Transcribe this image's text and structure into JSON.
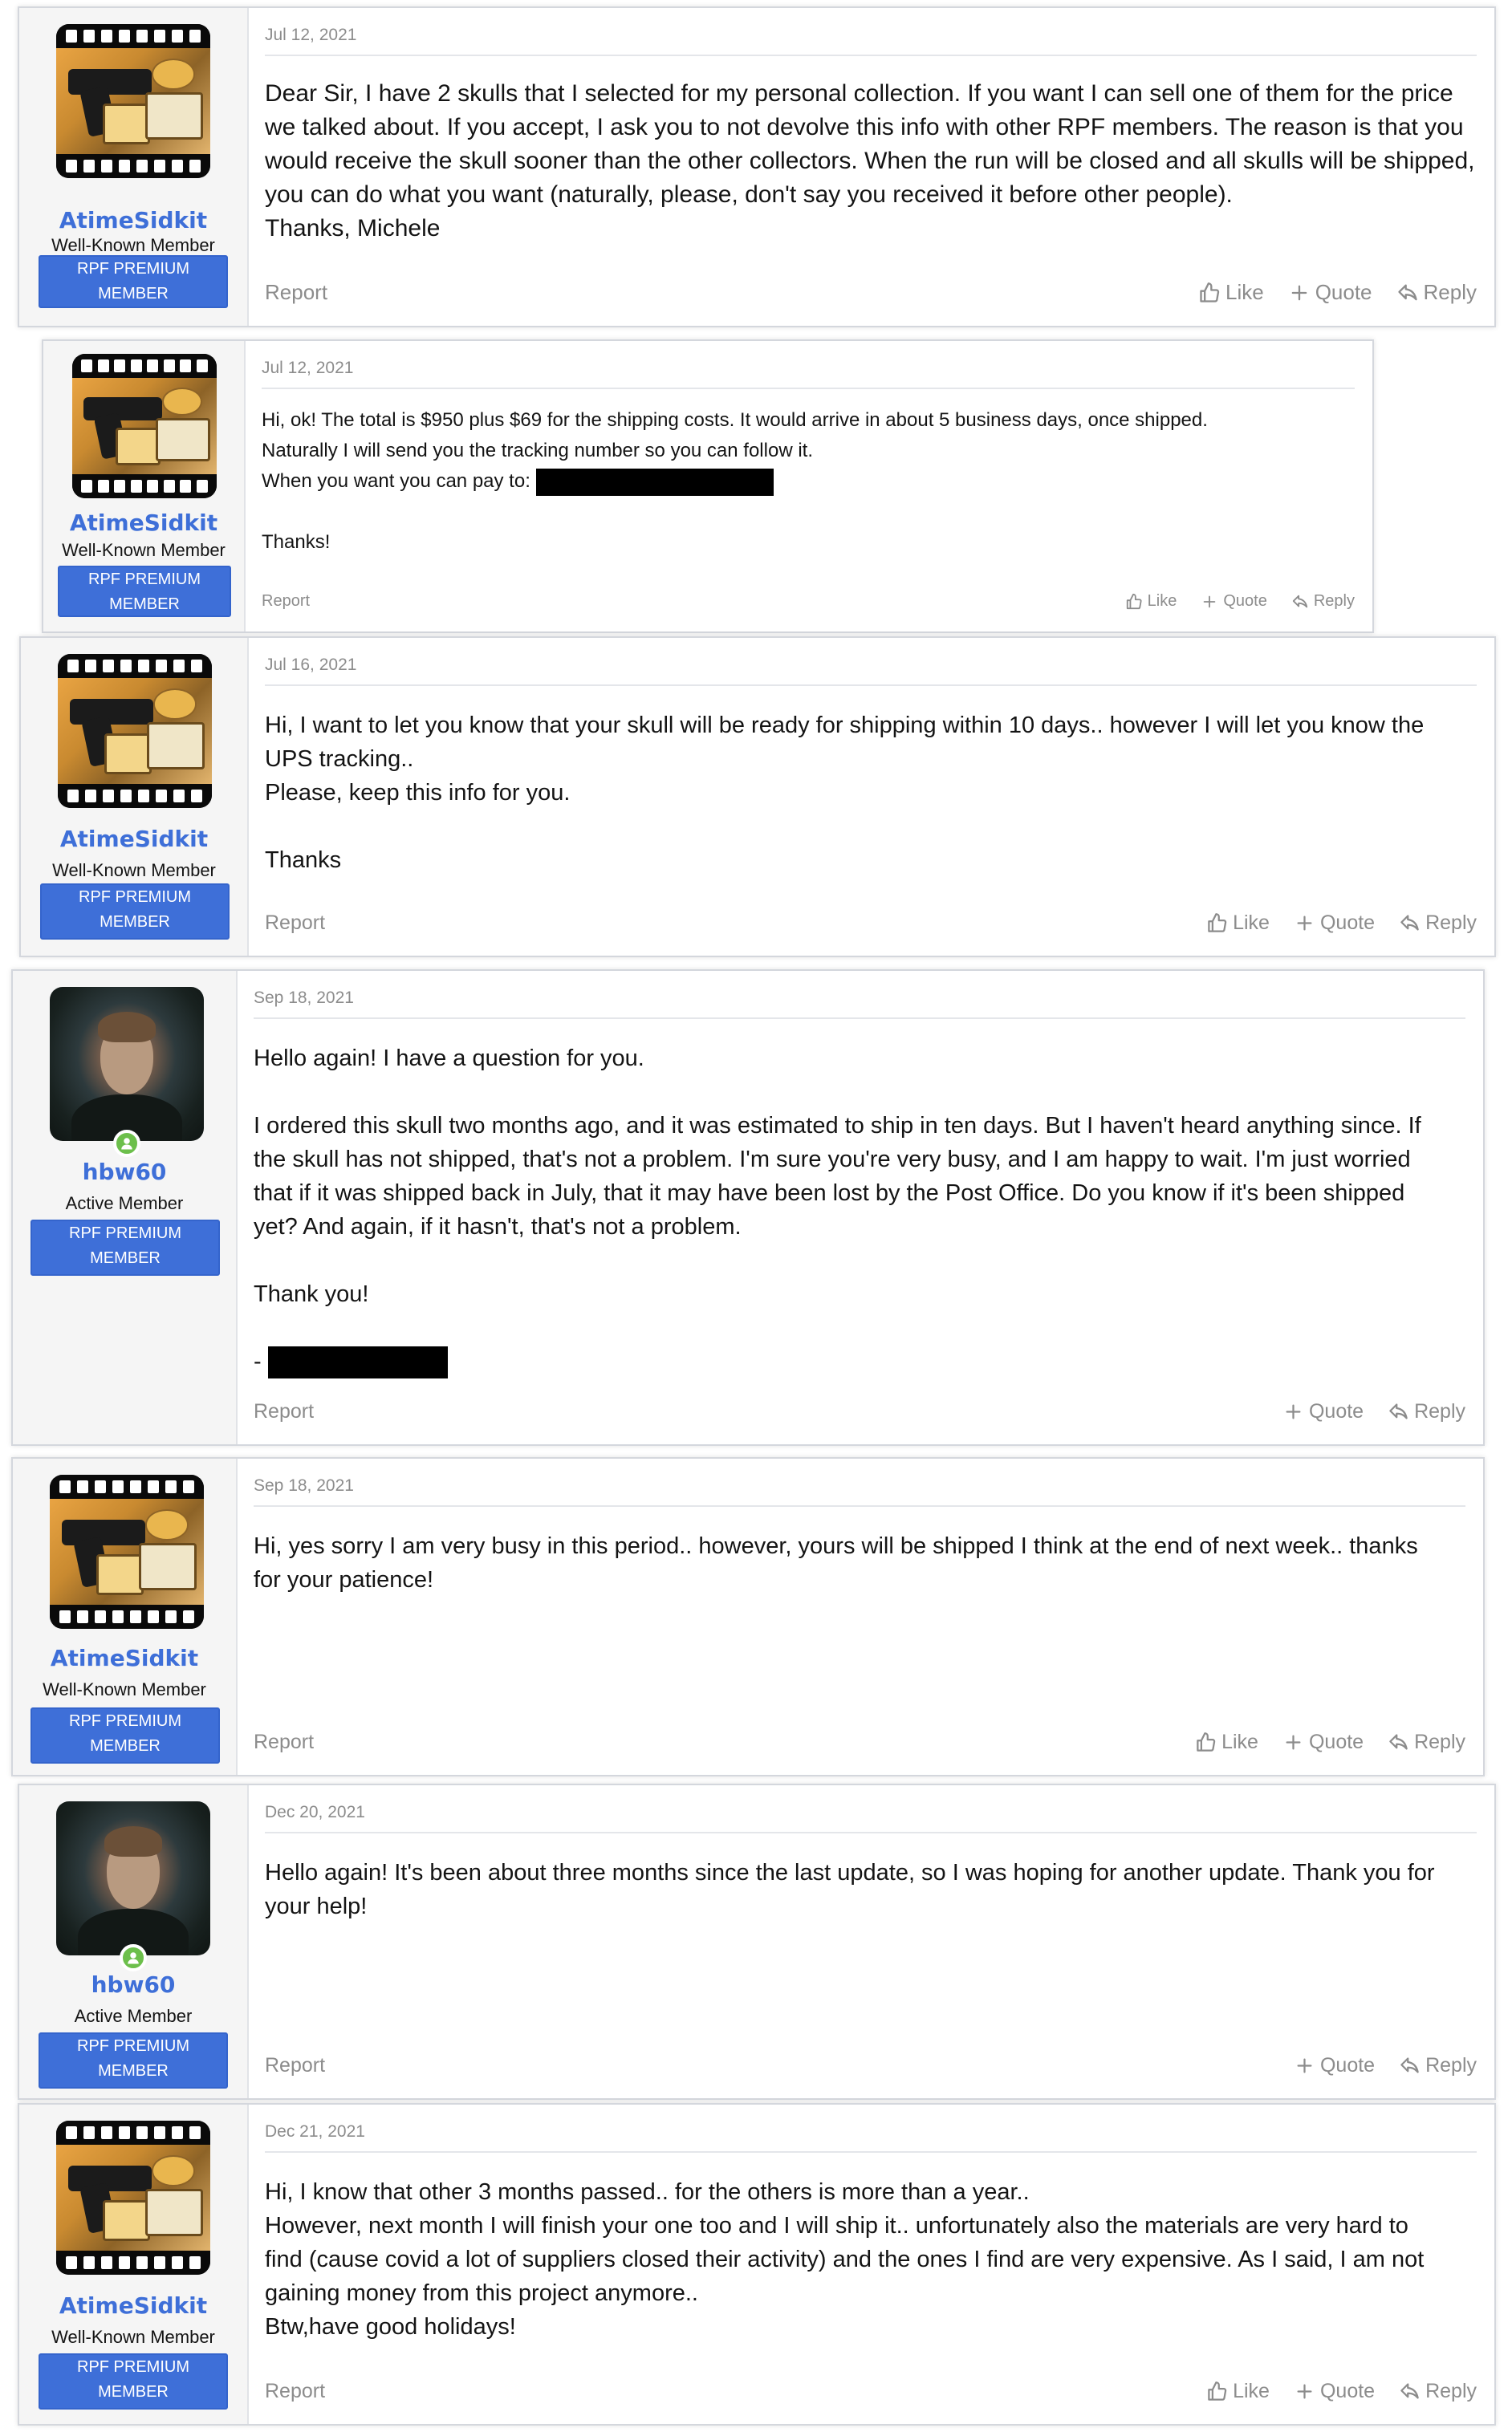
{
  "actions": {
    "report": "Report",
    "like": "Like",
    "quote": "Quote",
    "reply": "Reply"
  },
  "badge_label": "RPF PREMIUM MEMBER",
  "colors": {
    "username": "#3e6fd8",
    "badge_bg": "#3e6fd8",
    "online": "#6cbf4b"
  },
  "posts": [
    {
      "author": "AtimeSidkit",
      "user_title": "Well-Known Member",
      "badge": "RPF PREMIUM MEMBER",
      "avatar_icon": "kodak-film-avatar",
      "date": "Jul 12, 2021",
      "lines": [
        "Dear Sir, I have 2 skulls that I selected for my personal collection. If you want I can sell one of them for the price",
        "we talked about. If you accept, I ask you to not devolve this info with other RPF members. The reason is that you",
        "would receive the skull sooner than the other collectors. When the run will be closed and all skulls will be shipped,",
        "you can do what you want (naturally, please, don't say you received it before other people).",
        "Thanks, Michele"
      ],
      "has_like": true
    },
    {
      "author": "AtimeSidkit",
      "user_title": "Well-Known Member",
      "badge": "RPF PREMIUM MEMBER",
      "avatar_icon": "kodak-film-avatar",
      "date": "Jul 12, 2021",
      "lines": [
        "Hi, ok! The total is $950 plus $69 for the shipping costs. It would arrive in about 5 business days, once shipped.",
        "Naturally I will send you the tracking number so you can follow it.",
        "When you want you can pay to: ",
        "",
        "Thanks!"
      ],
      "has_like": true
    },
    {
      "author": "AtimeSidkit",
      "user_title": "Well-Known Member",
      "badge": "RPF PREMIUM MEMBER",
      "avatar_icon": "kodak-film-avatar",
      "date": "Jul 16, 2021",
      "lines": [
        "Hi, I want to let you know that your skull will be ready for shipping within 10 days.. however I will let you know the",
        "UPS tracking..",
        "Please, keep this info for you.",
        "",
        "Thanks"
      ],
      "has_like": true
    },
    {
      "author": "hbw60",
      "user_title": "Active Member",
      "badge": "RPF PREMIUM MEMBER",
      "avatar_icon": "user-photo-avatar",
      "date": "Sep 18, 2021",
      "lines": [
        "Hello again! I have a question for you.",
        "",
        "I ordered this skull two months ago, and it was estimated to ship in ten days. But I haven't heard anything since. If",
        "the skull has not shipped, that's not a problem. I'm sure you're very busy, and I am happy to wait. I'm just worried",
        "that if it was shipped back in July, that it may have been lost by the Post Office. Do you know if it's been shipped",
        "yet? And again, if it hasn't, that's not a problem.",
        "",
        "Thank you!",
        "",
        "- "
      ],
      "has_like": false
    },
    {
      "author": "AtimeSidkit",
      "user_title": "Well-Known Member",
      "badge": "RPF PREMIUM MEMBER",
      "avatar_icon": "kodak-film-avatar",
      "date": "Sep 18, 2021",
      "lines": [
        "Hi, yes sorry I am very busy in this period.. however, yours will be shipped I think at the end of next week.. thanks",
        "for your patience!"
      ],
      "has_like": true
    },
    {
      "author": "hbw60",
      "user_title": "Active Member",
      "badge": "RPF PREMIUM MEMBER",
      "avatar_icon": "user-photo-avatar",
      "date": "Dec 20, 2021",
      "lines": [
        "Hello again! It's been about three months since the last update, so I was hoping for another update. Thank you for",
        "your help!"
      ],
      "has_like": false
    },
    {
      "author": "AtimeSidkit",
      "user_title": "Well-Known Member",
      "badge": "RPF PREMIUM MEMBER",
      "avatar_icon": "kodak-film-avatar",
      "date": "Dec 21, 2021",
      "lines": [
        "Hi, I know that other 3 months passed.. for the others is more than a year..",
        "However, next month I will finish your one too and I will ship it.. unfortunately also the materials are very hard to",
        "find (cause covid a lot of suppliers closed their activity) and the ones I find are very expensive. As I said, I am not",
        "gaining money from this project anymore..",
        "Btw,have good holidays!"
      ],
      "has_like": true
    }
  ]
}
